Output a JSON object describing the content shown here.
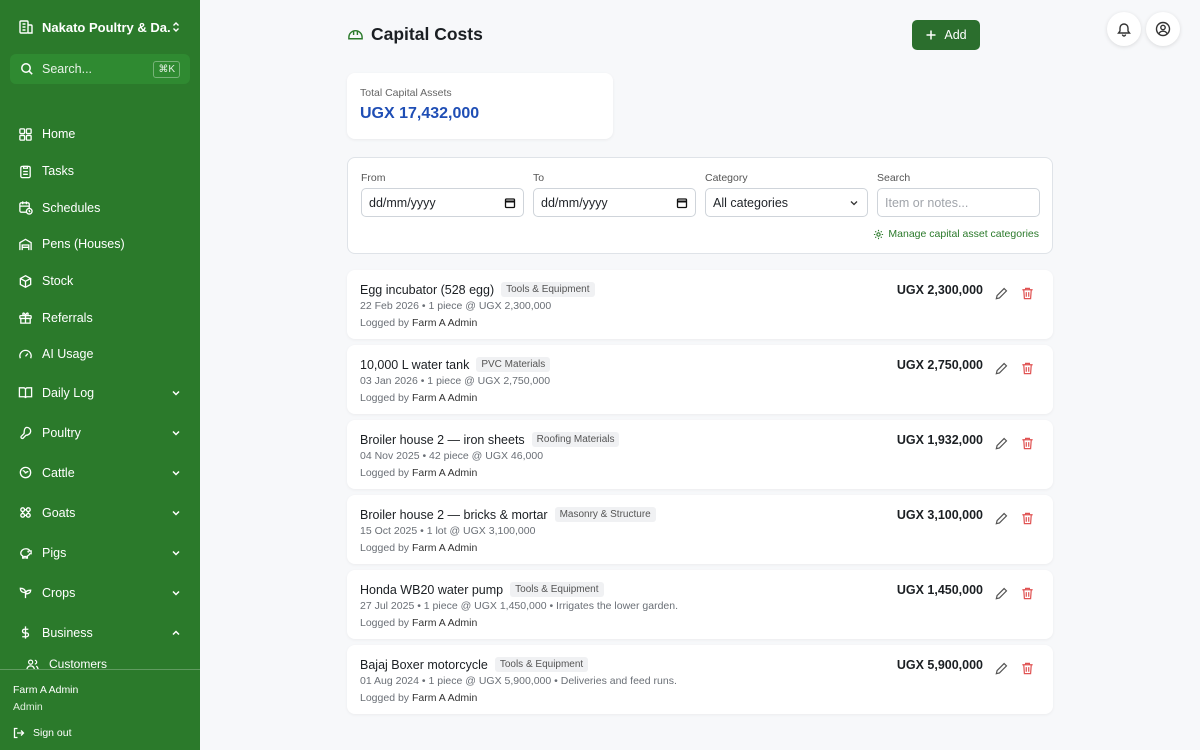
{
  "sidebar": {
    "farm_name": "Nakato Poultry & Da...",
    "search_placeholder": "Search...",
    "search_shortcut": "⌘K",
    "items": [
      {
        "label": "Home",
        "icon": "home-icon"
      },
      {
        "label": "Tasks",
        "icon": "clipboard-icon"
      },
      {
        "label": "Schedules",
        "icon": "calendar-clock-icon"
      },
      {
        "label": "Pens (Houses)",
        "icon": "warehouse-icon"
      },
      {
        "label": "Stock",
        "icon": "package-icon"
      },
      {
        "label": "Referrals",
        "icon": "gift-icon"
      },
      {
        "label": "AI Usage",
        "icon": "gauge-icon"
      }
    ],
    "groups": [
      {
        "label": "Daily Log",
        "icon": "book-icon",
        "expanded": false
      },
      {
        "label": "Poultry",
        "icon": "drumstick-icon",
        "expanded": false
      },
      {
        "label": "Cattle",
        "icon": "cattle-icon",
        "expanded": false
      },
      {
        "label": "Goats",
        "icon": "goat-icon",
        "expanded": false
      },
      {
        "label": "Pigs",
        "icon": "pig-icon",
        "expanded": false
      },
      {
        "label": "Crops",
        "icon": "sprout-icon",
        "expanded": false
      },
      {
        "label": "Business",
        "icon": "dollar-icon",
        "expanded": true
      }
    ],
    "sub_item": "Customers",
    "user_name": "Farm A Admin",
    "user_role": "Admin",
    "sign_out": "Sign out"
  },
  "header": {
    "title": "Capital Costs",
    "add_label": "Add"
  },
  "summary": {
    "label": "Total Capital Assets",
    "value": "UGX 17,432,000"
  },
  "filters": {
    "from_label": "From",
    "from_value": "dd/mm/yyyy",
    "to_label": "To",
    "to_value": "dd/mm/yyyy",
    "category_label": "Category",
    "category_value": "All categories",
    "search_label": "Search",
    "search_placeholder": "Item or notes...",
    "manage_link": "Manage capital asset categories"
  },
  "entries": [
    {
      "item": "Egg incubator (528 egg)",
      "category": "Tools & Equipment",
      "meta": "22 Feb 2026 • 1 piece @ UGX 2,300,000",
      "logged_prefix": "Logged by",
      "logged_by": "Farm A Admin",
      "amount": "UGX 2,300,000"
    },
    {
      "item": "10,000 L water tank",
      "category": "PVC Materials",
      "meta": "03 Jan 2026 • 1 piece @ UGX 2,750,000",
      "logged_prefix": "Logged by",
      "logged_by": "Farm A Admin",
      "amount": "UGX 2,750,000"
    },
    {
      "item": "Broiler house 2 — iron sheets",
      "category": "Roofing Materials",
      "meta": "04 Nov 2025 • 42 piece @ UGX 46,000",
      "logged_prefix": "Logged by",
      "logged_by": "Farm A Admin",
      "amount": "UGX 1,932,000"
    },
    {
      "item": "Broiler house 2 — bricks & mortar",
      "category": "Masonry & Structure",
      "meta": "15 Oct 2025 • 1 lot @ UGX 3,100,000",
      "logged_prefix": "Logged by",
      "logged_by": "Farm A Admin",
      "amount": "UGX 3,100,000"
    },
    {
      "item": "Honda WB20 water pump",
      "category": "Tools & Equipment",
      "meta": "27 Jul 2025 • 1 piece @ UGX 1,450,000 • Irrigates the lower garden.",
      "logged_prefix": "Logged by",
      "logged_by": "Farm A Admin",
      "amount": "UGX 1,450,000"
    },
    {
      "item": "Bajaj Boxer motorcycle",
      "category": "Tools & Equipment",
      "meta": "01 Aug 2024 • 1 piece @ UGX 5,900,000 • Deliveries and feed runs.",
      "logged_prefix": "Logged by",
      "logged_by": "Farm A Admin",
      "amount": "UGX 5,900,000"
    }
  ],
  "colors": {
    "sidebar_bg": "#2b7a2b",
    "primary_button": "#2b6e2d",
    "total_value": "#1f4eb5",
    "delete_icon": "#e05252"
  }
}
